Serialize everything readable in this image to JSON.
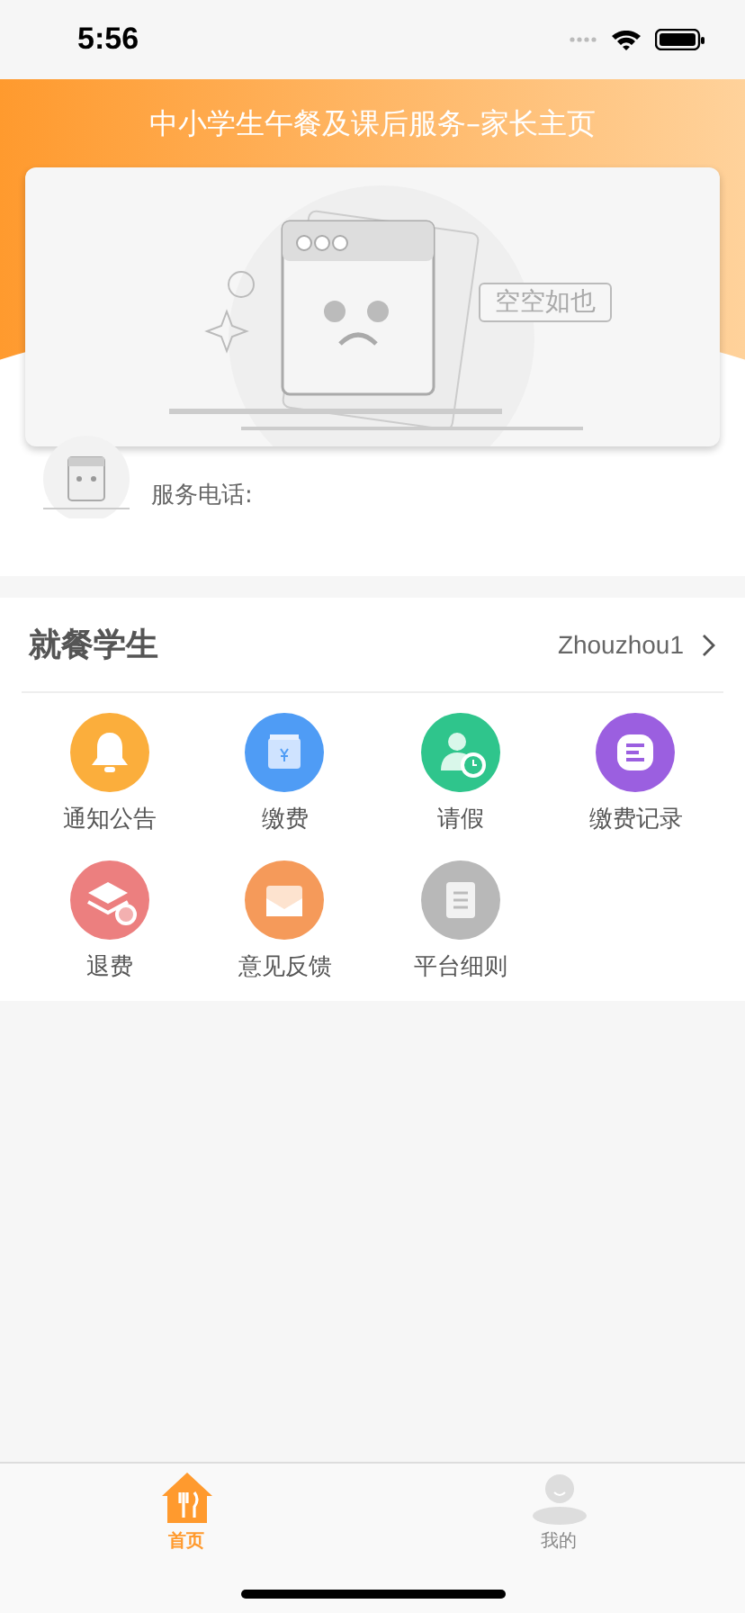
{
  "status_bar": {
    "time": "5:56"
  },
  "header": {
    "title": "中小学生午餐及课后服务–家长主页"
  },
  "banner": {
    "caption": "空空如也"
  },
  "service": {
    "label": "服务电话:"
  },
  "students": {
    "title": "就餐学生",
    "name": "Zhouzhou1"
  },
  "menu": [
    {
      "label": "通知公告",
      "kind": "bell",
      "color": "#fbae3c"
    },
    {
      "label": "缴费",
      "kind": "wallet",
      "color": "#4f9cf5"
    },
    {
      "label": "请假",
      "kind": "leave",
      "color": "#2fc58c"
    },
    {
      "label": "缴费记录",
      "kind": "record",
      "color": "#9b5fe0"
    },
    {
      "label": "退费",
      "kind": "refund",
      "color": "#ec7f7f"
    },
    {
      "label": "意见反馈",
      "kind": "mail",
      "color": "#f59a5a"
    },
    {
      "label": "平台细则",
      "kind": "rules",
      "color": "#b8b8b8"
    }
  ],
  "tab_bar": [
    {
      "label": "首页",
      "kind": "home",
      "selected": true
    },
    {
      "label": "我的",
      "kind": "user",
      "selected": false
    }
  ]
}
